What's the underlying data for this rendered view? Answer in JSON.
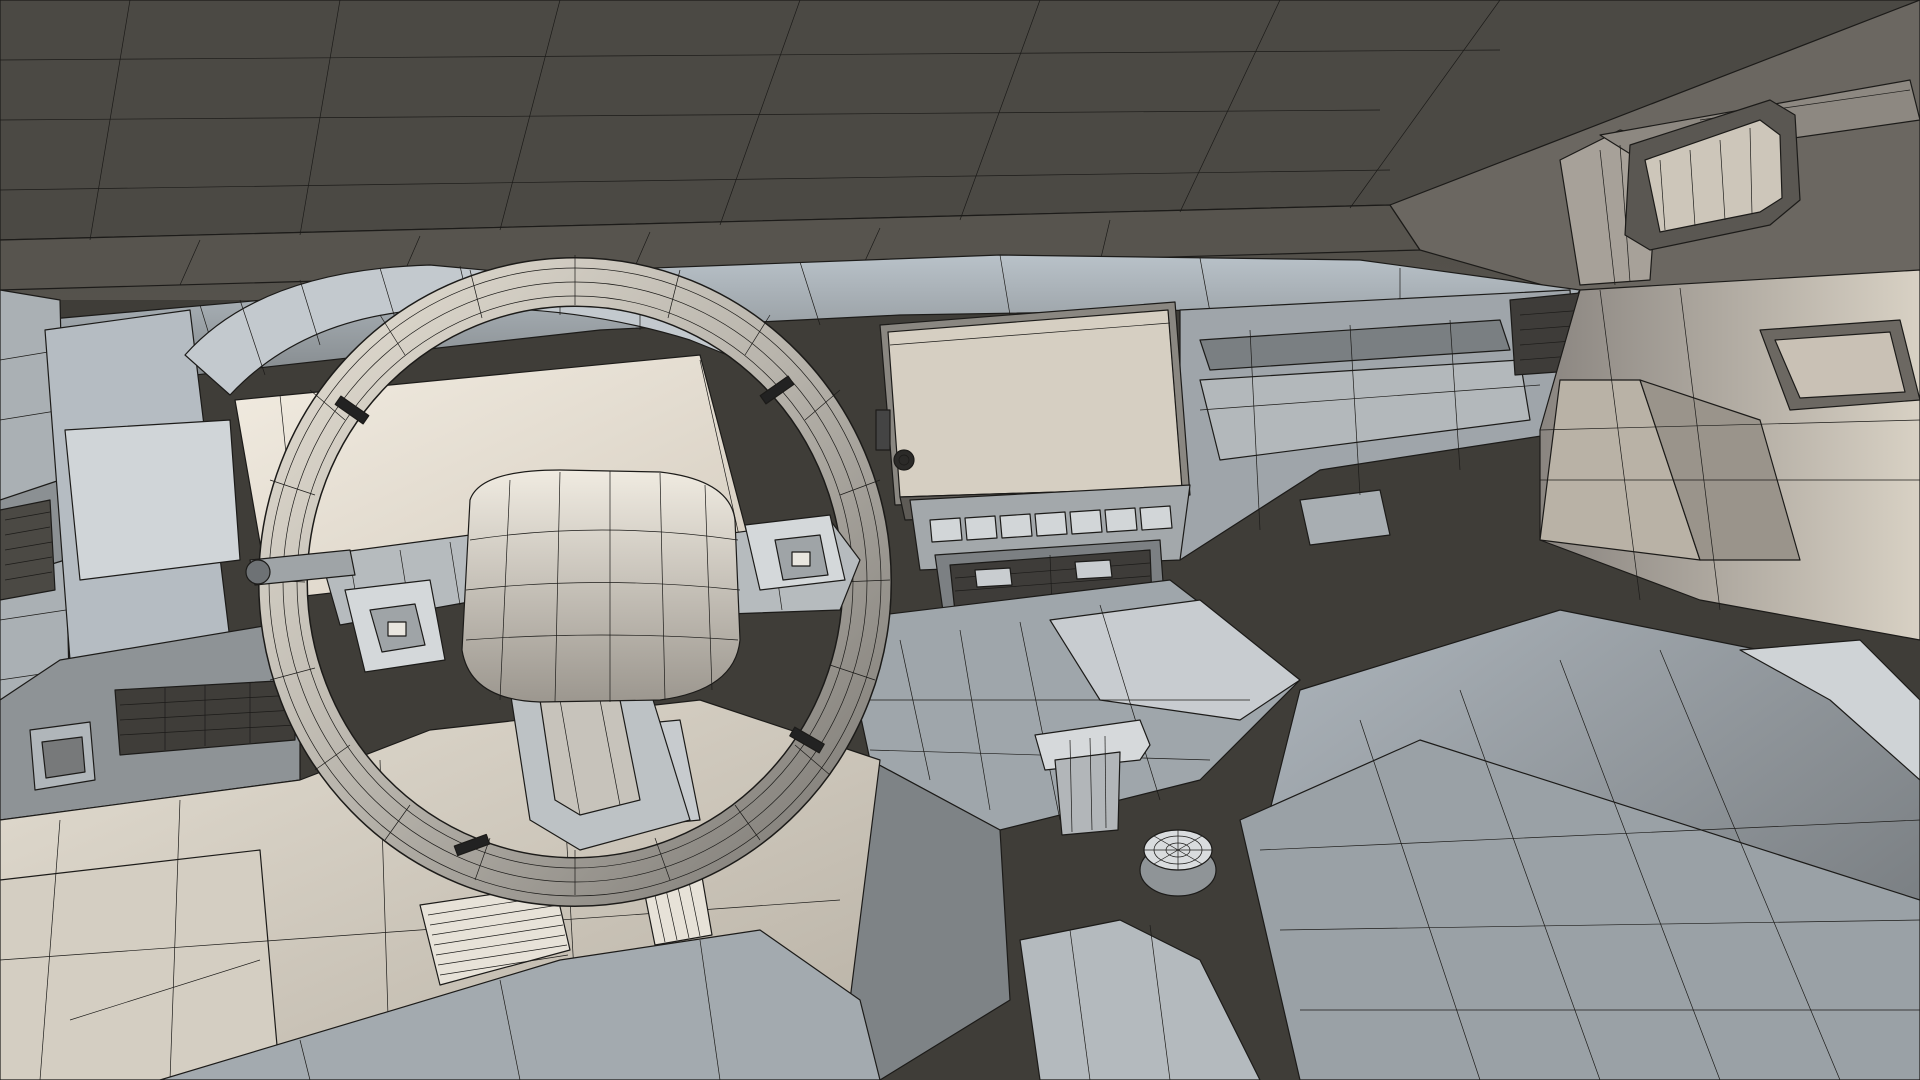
{
  "viewport": {
    "shading": "wireframe-on-shaded",
    "view": "perspective",
    "subject": "vehicle-interior"
  },
  "colors": {
    "background": "#3f3d38",
    "headliner": "#4a4843",
    "shaded_light": "#d9d4c9",
    "shaded_mid": "#a9adb0",
    "shaded_dark": "#5d5a54",
    "wire": "#1c1b19"
  }
}
